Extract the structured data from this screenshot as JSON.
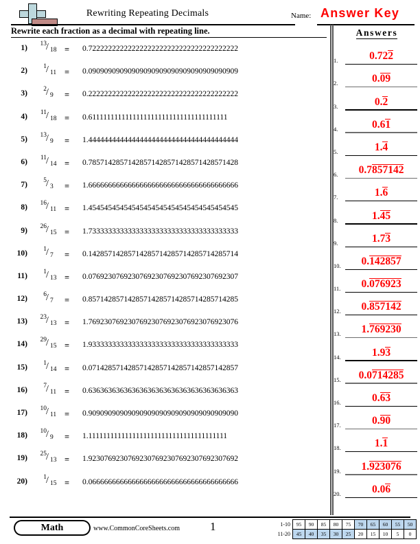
{
  "header": {
    "title": "Rewriting Repeating Decimals",
    "name_label": "Name:",
    "answer_key": "Answer Key",
    "logo_name": "commoncoresheets-logo"
  },
  "instruction": "Rewrite each fraction as a decimal with repeating line.",
  "answers_heading": "Answers",
  "problems": [
    {
      "num": "1)",
      "numerator": "13",
      "slash": "/",
      "denominator": "18",
      "equals": "=",
      "decimal": "0.72222222222222222222222222222222222222"
    },
    {
      "num": "2)",
      "numerator": "1",
      "slash": "/",
      "denominator": "11",
      "equals": "=",
      "decimal": "0.09090909090909090909090909090909090909"
    },
    {
      "num": "3)",
      "numerator": "2",
      "slash": "/",
      "denominator": "9",
      "equals": "=",
      "decimal": "0.22222222222222222222222222222222222222"
    },
    {
      "num": "4)",
      "numerator": "11",
      "slash": "/",
      "denominator": "18",
      "equals": "=",
      "decimal": "0.61111111111111111111111111111111111111"
    },
    {
      "num": "5)",
      "numerator": "13",
      "slash": "/",
      "denominator": "9",
      "equals": "=",
      "decimal": "1.44444444444444444444444444444444444444"
    },
    {
      "num": "6)",
      "numerator": "11",
      "slash": "/",
      "denominator": "14",
      "equals": "=",
      "decimal": "0.78571428571428571428571428571428571428"
    },
    {
      "num": "7)",
      "numerator": "5",
      "slash": "/",
      "denominator": "3",
      "equals": "=",
      "decimal": "1.66666666666666666666666666666666666666"
    },
    {
      "num": "8)",
      "numerator": "16",
      "slash": "/",
      "denominator": "11",
      "equals": "=",
      "decimal": "1.45454545454545454545454545454545454545"
    },
    {
      "num": "9)",
      "numerator": "26",
      "slash": "/",
      "denominator": "15",
      "equals": "=",
      "decimal": "1.73333333333333333333333333333333333333"
    },
    {
      "num": "10)",
      "numerator": "1",
      "slash": "/",
      "denominator": "7",
      "equals": "=",
      "decimal": "0.14285714285714285714285714285714285714"
    },
    {
      "num": "11)",
      "numerator": "1",
      "slash": "/",
      "denominator": "13",
      "equals": "=",
      "decimal": "0.07692307692307692307692307692307692307"
    },
    {
      "num": "12)",
      "numerator": "6",
      "slash": "/",
      "denominator": "7",
      "equals": "=",
      "decimal": "0.85714285714285714285714285714285714285"
    },
    {
      "num": "13)",
      "numerator": "23",
      "slash": "/",
      "denominator": "13",
      "equals": "=",
      "decimal": "1.76923076923076923076923076923076923076"
    },
    {
      "num": "14)",
      "numerator": "29",
      "slash": "/",
      "denominator": "15",
      "equals": "=",
      "decimal": "1.93333333333333333333333333333333333333"
    },
    {
      "num": "15)",
      "numerator": "1",
      "slash": "/",
      "denominator": "14",
      "equals": "=",
      "decimal": "0.07142857142857142857142857142857142857"
    },
    {
      "num": "16)",
      "numerator": "7",
      "slash": "/",
      "denominator": "11",
      "equals": "=",
      "decimal": "0.63636363636363636363636363636363636363"
    },
    {
      "num": "17)",
      "numerator": "10",
      "slash": "/",
      "denominator": "11",
      "equals": "=",
      "decimal": "0.90909090909090909090909090909090909090"
    },
    {
      "num": "18)",
      "numerator": "10",
      "slash": "/",
      "denominator": "9",
      "equals": "=",
      "decimal": "1.11111111111111111111111111111111111111"
    },
    {
      "num": "19)",
      "numerator": "25",
      "slash": "/",
      "denominator": "13",
      "equals": "=",
      "decimal": "1.92307692307692307692307692307692307692"
    },
    {
      "num": "20)",
      "numerator": "1",
      "slash": "/",
      "denominator": "15",
      "equals": "=",
      "decimal": "0.06666666666666666666666666666666666666"
    }
  ],
  "answers": [
    {
      "num": "1.",
      "prefix": "0.72",
      "repeat": "2",
      "full": "0.722222...",
      "line": "black"
    },
    {
      "num": "2.",
      "prefix": "0.",
      "repeat": "09",
      "full": "0.090909...",
      "line": "grey"
    },
    {
      "num": "3.",
      "prefix": "0.",
      "repeat": "2",
      "full": "0.222222...",
      "line": "black"
    },
    {
      "num": "4.",
      "prefix": "0.6",
      "repeat": "1",
      "full": "0.611111...",
      "line": "grey"
    },
    {
      "num": "5.",
      "prefix": "1.",
      "repeat": "4",
      "full": "1.444444...",
      "line": "black"
    },
    {
      "num": "6.",
      "prefix": "0.7",
      "repeat": "857142",
      "full": "0.7857142857142...",
      "line": "grey"
    },
    {
      "num": "7.",
      "prefix": "1.",
      "repeat": "6",
      "full": "1.666666...",
      "line": "black"
    },
    {
      "num": "8.",
      "prefix": "1.",
      "repeat": "45",
      "full": "1.454545...",
      "line": "black"
    },
    {
      "num": "9.",
      "prefix": "1.7",
      "repeat": "3",
      "full": "1.733333...",
      "line": "black"
    },
    {
      "num": "10.",
      "prefix": "0.",
      "repeat": "142857",
      "full": "0.142857142857...",
      "line": "black"
    },
    {
      "num": "11.",
      "prefix": "0.",
      "repeat": "076923",
      "full": "0.076923076923...",
      "line": "black"
    },
    {
      "num": "12.",
      "prefix": "0.",
      "repeat": "857142",
      "full": "0.857142857142...",
      "line": "black"
    },
    {
      "num": "13.",
      "prefix": "1.",
      "repeat": "769230",
      "full": "1.769230769230...",
      "line": "grey"
    },
    {
      "num": "14.",
      "prefix": "1.9",
      "repeat": "3",
      "full": "1.933333...",
      "line": "black"
    },
    {
      "num": "15.",
      "prefix": "0.0",
      "repeat": "714285",
      "full": "0.0714285714285...",
      "line": "grey"
    },
    {
      "num": "16.",
      "prefix": "0.",
      "repeat": "63",
      "full": "0.636363...",
      "line": "black"
    },
    {
      "num": "17.",
      "prefix": "0.",
      "repeat": "90",
      "full": "0.909090...",
      "line": "grey"
    },
    {
      "num": "18.",
      "prefix": "1.",
      "repeat": "1",
      "full": "1.111111...",
      "line": "black"
    },
    {
      "num": "19.",
      "prefix": "1.",
      "repeat": "923076",
      "full": "1.923076923076...",
      "line": "grey"
    },
    {
      "num": "20.",
      "prefix": "0.0",
      "repeat": "6",
      "full": "0.066666...",
      "line": "black"
    }
  ],
  "footer": {
    "brand": "Math",
    "site": "www.CommonCoreSheets.com",
    "page_number": "1",
    "scale": {
      "row1_label": "1-10",
      "row2_label": "11-20",
      "row1": [
        {
          "v": "95",
          "hl": false
        },
        {
          "v": "90",
          "hl": false
        },
        {
          "v": "85",
          "hl": false
        },
        {
          "v": "80",
          "hl": false
        },
        {
          "v": "75",
          "hl": false
        },
        {
          "v": "70",
          "hl": true
        },
        {
          "v": "65",
          "hl": true
        },
        {
          "v": "60",
          "hl": true
        },
        {
          "v": "55",
          "hl": true
        },
        {
          "v": "50",
          "hl": true
        }
      ],
      "row2": [
        {
          "v": "45",
          "hl": true
        },
        {
          "v": "40",
          "hl": true
        },
        {
          "v": "35",
          "hl": true
        },
        {
          "v": "30",
          "hl": true
        },
        {
          "v": "25",
          "hl": true
        },
        {
          "v": "20",
          "hl": false
        },
        {
          "v": "15",
          "hl": false
        },
        {
          "v": "10",
          "hl": false
        },
        {
          "v": "5",
          "hl": false
        },
        {
          "v": "0",
          "hl": false
        }
      ]
    }
  },
  "colors": {
    "answer_red": "#fe0000",
    "highlight_blue": "#bdd7ee",
    "logo_blue": "#bcd8dd",
    "logo_red": "#c08a86"
  }
}
